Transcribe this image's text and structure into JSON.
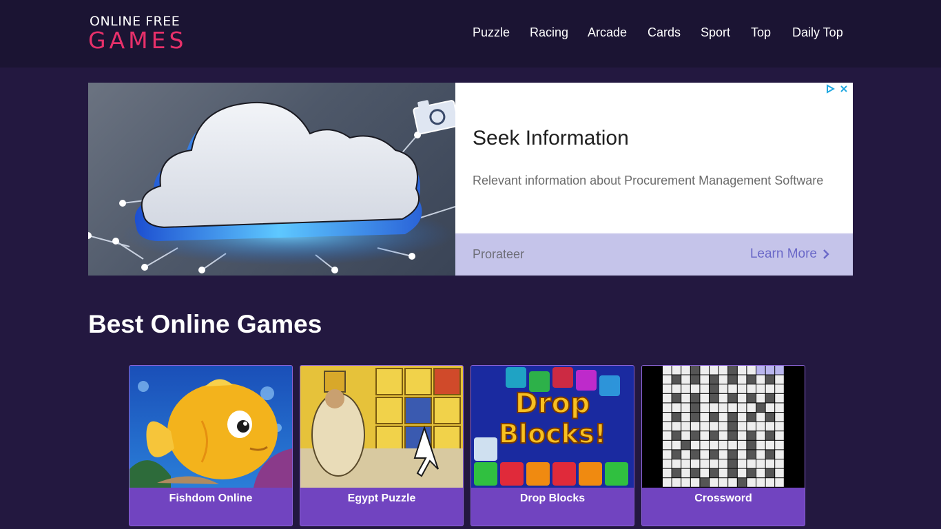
{
  "site": {
    "logo_top": "ONLINE FREE",
    "logo_bottom": "GAMES",
    "brand_color": "#e8306a"
  },
  "nav": [
    {
      "label": "Puzzle"
    },
    {
      "label": "Racing"
    },
    {
      "label": "Arcade"
    },
    {
      "label": "Cards"
    },
    {
      "label": "Sport"
    },
    {
      "label": "Top"
    },
    {
      "label": "Daily Top"
    }
  ],
  "ad": {
    "title": "Seek Information",
    "description": "Relevant information about Procurement Management Software",
    "advertiser": "Prorateer",
    "cta": "Learn More",
    "image_icon": "cloud-network-illustration",
    "choices_icon": "adchoices-icon",
    "close_icon": "close-icon"
  },
  "section": {
    "title": "Best Online Games"
  },
  "games": [
    {
      "title": "Fishdom Online",
      "thumb_icon": "goldfish-thumbnail"
    },
    {
      "title": "Egypt Puzzle",
      "thumb_icon": "egyptian-tiles-thumbnail"
    },
    {
      "title": "Drop Blocks",
      "thumb_icon": "drop-blocks-thumbnail"
    },
    {
      "title": "Crossword",
      "thumb_icon": "crossword-grid-thumbnail"
    }
  ],
  "colors": {
    "page_bg": "#231840",
    "header_bg": "#1b1433",
    "card_bg": "#7144c0",
    "ad_footer_bg": "#c5c4ea",
    "ad_cta": "#6a68c8"
  }
}
